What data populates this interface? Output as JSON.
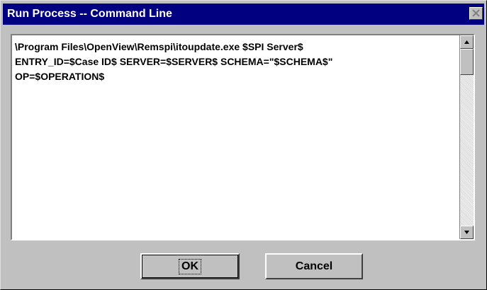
{
  "window": {
    "title": "Run Process -- Command Line"
  },
  "editor": {
    "text": "\\Program Files\\OpenView\\Remspi\\itoupdate.exe $SPI Server$\nENTRY_ID=$Case ID$ SERVER=$SERVER$ SCHEMA=\"$SCHEMA$\"\nOP=$OPERATION$"
  },
  "buttons": {
    "ok": "OK",
    "cancel": "Cancel"
  },
  "icons": {
    "close": "close-icon",
    "scroll_up": "arrow-up-icon",
    "scroll_down": "arrow-down-icon"
  },
  "colors": {
    "titlebar": "#000080",
    "window_background": "#c0c0c0",
    "text_background": "#ffffff"
  }
}
